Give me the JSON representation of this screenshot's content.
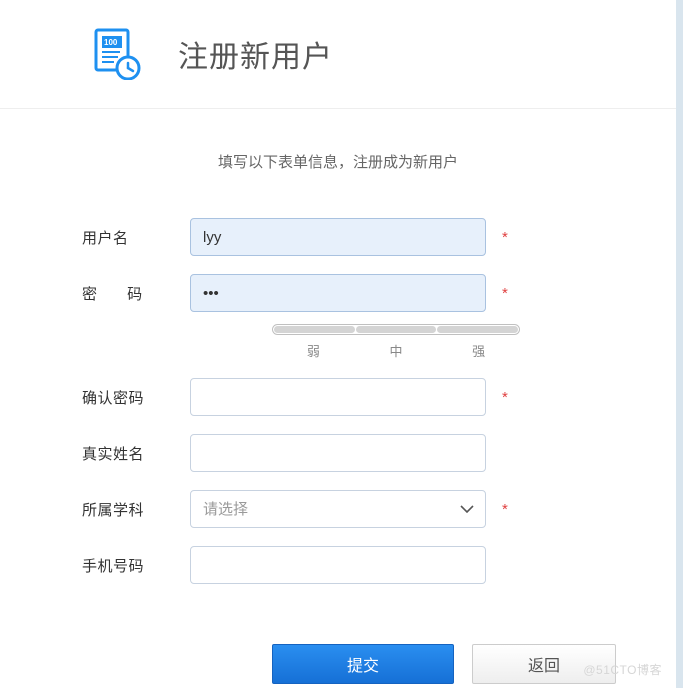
{
  "header": {
    "title": "注册新用户",
    "icon": "invoice-clock-icon"
  },
  "instruction": "填写以下表单信息，注册成为新用户",
  "form": {
    "username": {
      "label": "用户名",
      "value": "lyy",
      "required": true
    },
    "password": {
      "label": "密 码",
      "value": "•••",
      "required": true
    },
    "strength": {
      "weak": "弱",
      "medium": "中",
      "strong": "强"
    },
    "confirm_password": {
      "label": "确认密码",
      "value": "",
      "required": true
    },
    "real_name": {
      "label": "真实姓名",
      "value": ""
    },
    "subject": {
      "label": "所属学科",
      "placeholder": "请选择",
      "required": true
    },
    "phone": {
      "label": "手机号码",
      "value": ""
    }
  },
  "buttons": {
    "submit": "提交",
    "back": "返回"
  },
  "watermark": "@51CTO博客",
  "required_mark": "*"
}
